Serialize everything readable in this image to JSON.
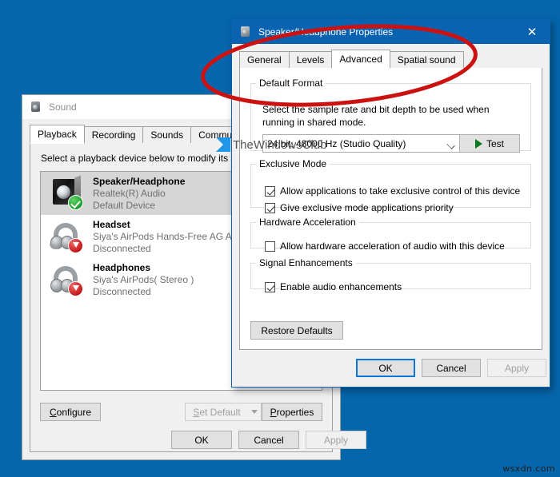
{
  "desktop": {
    "background_color": "#0566ac",
    "corner_watermark": "wsxdn.com"
  },
  "watermark": {
    "text": "TheWindowsClub",
    "logo_color": "#2196e8"
  },
  "annotation": {
    "shape": "ellipse",
    "color": "#cc1111",
    "target": "Advanced tab"
  },
  "sound_window": {
    "title": "Sound",
    "icon": "speaker-icon",
    "active": false,
    "tabs": [
      {
        "label": "Playback",
        "active": true
      },
      {
        "label": "Recording",
        "active": false
      },
      {
        "label": "Sounds",
        "active": false
      },
      {
        "label": "Communications",
        "active": false
      }
    ],
    "hint": "Select a playback device below to modify its settings:",
    "devices": [
      {
        "name": "Speaker/Headphone",
        "driver": "Realtek(R) Audio",
        "status": "Default Device",
        "icon": "speaker-device-icon",
        "badge": "check-badge",
        "selected": true
      },
      {
        "name": "Headset",
        "driver": "Siya's AirPods Hands-Free AG Audio",
        "status": "Disconnected",
        "icon": "headset-device-icon",
        "badge": "down-arrow-badge",
        "selected": false
      },
      {
        "name": "Headphones",
        "driver": "Siya's AirPods( Stereo )",
        "status": "Disconnected",
        "icon": "headphones-device-icon",
        "badge": "down-arrow-badge",
        "selected": false
      }
    ],
    "buttons": {
      "configure": {
        "label": "Configure",
        "accel": "C",
        "disabled": false
      },
      "set_default": {
        "label": "Set Default",
        "accel": "S",
        "disabled": true
      },
      "properties": {
        "label": "Properties",
        "accel": "P",
        "disabled": false
      }
    },
    "footer": {
      "ok": "OK",
      "cancel": "Cancel",
      "apply": "Apply",
      "apply_disabled": true
    }
  },
  "properties_dialog": {
    "title": "Speaker/Headphone Properties",
    "icon": "speaker-icon",
    "close_glyph": "✕",
    "active": true,
    "titlebar_color": "#0a63b0",
    "tabs": [
      {
        "label": "General",
        "active": false
      },
      {
        "label": "Levels",
        "active": false
      },
      {
        "label": "Advanced",
        "active": true
      },
      {
        "label": "Spatial sound",
        "active": false
      }
    ],
    "default_format": {
      "legend": "Default Format",
      "description": "Select the sample rate and bit depth to be used when running in shared mode.",
      "selected_value": "24 bit, 48000 Hz (Studio Quality)",
      "test_button": "Test"
    },
    "exclusive_mode": {
      "legend": "Exclusive Mode",
      "options": [
        {
          "label": "Allow applications to take exclusive control of this device",
          "checked": true
        },
        {
          "label": "Give exclusive mode applications priority",
          "checked": true
        }
      ]
    },
    "hardware_acceleration": {
      "legend": "Hardware Acceleration",
      "options": [
        {
          "label": "Allow hardware acceleration of audio with this device",
          "checked": false
        }
      ]
    },
    "signal_enhancements": {
      "legend": "Signal Enhancements",
      "options": [
        {
          "label": "Enable audio enhancements",
          "checked": true
        }
      ]
    },
    "restore_defaults": "Restore Defaults",
    "footer": {
      "ok": "OK",
      "cancel": "Cancel",
      "apply": "Apply",
      "apply_disabled": true,
      "ok_is_default": true
    }
  }
}
